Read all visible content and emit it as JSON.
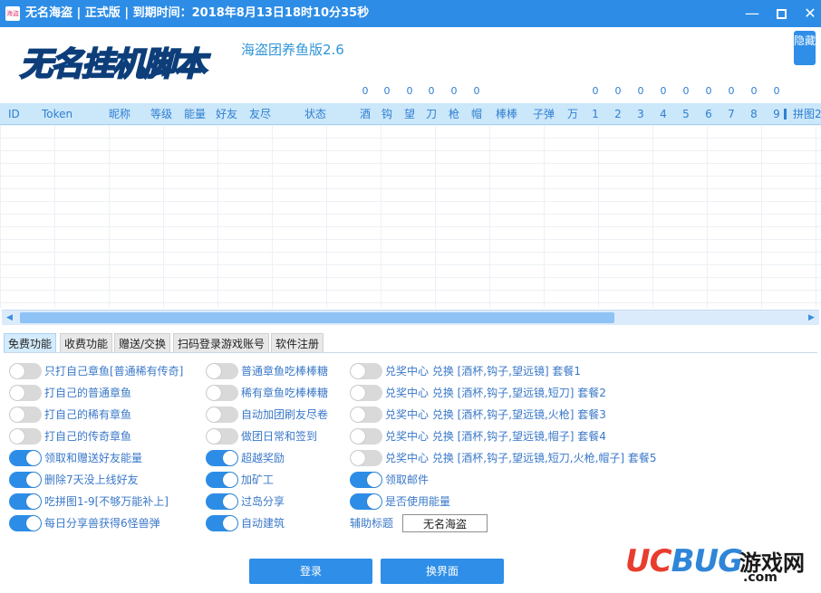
{
  "window": {
    "title": "无名海盗 | 正式版 | 到期时间：2018年8月13日18时10分35秒",
    "icon_text": "海盗",
    "minimize": "—",
    "close": "✕"
  },
  "header": {
    "logo_text": "无名挂机脚本",
    "subtitle": "海盗团养鱼版2.6",
    "hide_button": "隐藏"
  },
  "counts": [
    "0",
    "0",
    "0",
    "0",
    "0",
    "0",
    "0",
    "0",
    "0",
    "0",
    "0",
    "0",
    "0",
    "0",
    "0"
  ],
  "table": {
    "columns": [
      "ID",
      "Token",
      "昵称",
      "等级",
      "能量",
      "好友",
      "友尽",
      "状态",
      "酒",
      "钩",
      "望",
      "刀",
      "枪",
      "帽",
      "棒棒",
      "子弹",
      "万",
      "1",
      "2",
      "3",
      "4",
      "5",
      "6",
      "7",
      "8",
      "9",
      "拼图2"
    ]
  },
  "tabs": [
    "免费功能",
    "收费功能",
    "赠送/交换",
    "扫码登录游戏账号",
    "软件注册"
  ],
  "options": {
    "col1": [
      {
        "label": "只打自己章鱼[普通稀有传奇]",
        "on": false
      },
      {
        "label": "打自己的普通章鱼",
        "on": false
      },
      {
        "label": "打自己的稀有章鱼",
        "on": false
      },
      {
        "label": "打自己的传奇章鱼",
        "on": false
      },
      {
        "label": "领取和赠送好友能量",
        "on": true
      },
      {
        "label": "删除7天没上线好友",
        "on": true
      },
      {
        "label": "吃拼图1-9[不够万能补上]",
        "on": true
      },
      {
        "label": "每日分享兽获得6怪兽弹",
        "on": true
      }
    ],
    "col2": [
      {
        "label": "普通章鱼吃棒棒糖",
        "on": false
      },
      {
        "label": "稀有章鱼吃棒棒糖",
        "on": false
      },
      {
        "label": "自动加团刷友尽卷",
        "on": false
      },
      {
        "label": "做团日常和签到",
        "on": false
      },
      {
        "label": "超越奖励",
        "on": true
      },
      {
        "label": "加矿工",
        "on": true
      },
      {
        "label": "过岛分享",
        "on": true
      },
      {
        "label": "自动建筑",
        "on": true
      }
    ],
    "col3": [
      {
        "label": "兑奖中心 兑换 [酒杯,钩子,望远镜] 套餐1",
        "on": false
      },
      {
        "label": "兑奖中心 兑换 [酒杯,钩子,望远镜,短刀] 套餐2",
        "on": false
      },
      {
        "label": "兑奖中心 兑换 [酒杯,钩子,望远镜,火枪] 套餐3",
        "on": false
      },
      {
        "label": "兑奖中心 兑换 [酒杯,钩子,望远镜,帽子] 套餐4",
        "on": false
      },
      {
        "label": "兑奖中心 兑换 [酒杯,钩子,望远镜,短刀,火枪,帽子] 套餐5",
        "on": false
      },
      {
        "label": "领取邮件",
        "on": true
      },
      {
        "label": "是否使用能量",
        "on": true
      }
    ]
  },
  "aux": {
    "label": "辅助标题",
    "value": "无名海盗"
  },
  "buttons": {
    "login": "登录",
    "switch": "换界面"
  },
  "watermark": {
    "uc": "UC",
    "bug": "BUG",
    "game": "游戏网",
    "com": ".com"
  },
  "colors": {
    "titlebar": "#2d8de6",
    "accent": "#2e8ee8",
    "toggle_off": "#d9d9d9",
    "label_blue": "#3a78c8"
  }
}
